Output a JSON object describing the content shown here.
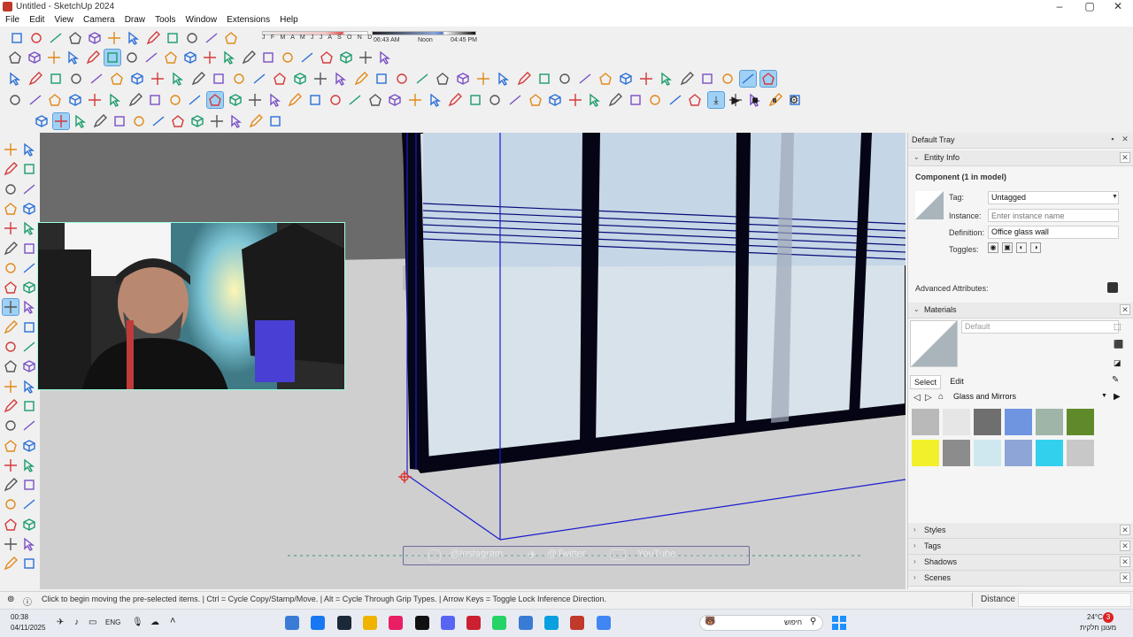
{
  "window": {
    "title": "Untitled - SketchUp 2024"
  },
  "menu": [
    "File",
    "Edit",
    "View",
    "Camera",
    "Draw",
    "Tools",
    "Window",
    "Extensions",
    "Help"
  ],
  "shadow": {
    "months": "J F M A M J J A S O N D",
    "time_start": "06:43 AM",
    "time_noon": "Noon",
    "time_end": "04:45 PM"
  },
  "tray": {
    "title": "Default Tray",
    "entity_info": {
      "header": "Entity Info",
      "heading": "Component (1 in model)",
      "tag_label": "Tag:",
      "tag_value": "Untagged",
      "instance_label": "Instance:",
      "instance_placeholder": "Enter instance name",
      "definition_label": "Definition:",
      "definition_value": "Office glass wall",
      "toggles_label": "Toggles:",
      "advanced_label": "Advanced Attributes:"
    },
    "materials": {
      "header": "Materials",
      "current_name": "Default",
      "tab_select": "Select",
      "tab_edit": "Edit",
      "library": "Glass and Mirrors",
      "swatches": [
        "#b9b9b9",
        "#e6e6e6",
        "#6f6f6f",
        "#6f95e0",
        "#9fb5a8",
        "#5f8a2a",
        "#f2f02a",
        "#8c8c8c",
        "#cfe8f0",
        "#8ea5d8",
        "#33d0ee",
        "#c8c8c8"
      ]
    },
    "collapsed_panels": [
      "Styles",
      "Tags",
      "Shadows",
      "Scenes"
    ]
  },
  "status": {
    "hint": "Click to begin moving the pre-selected items. | Ctrl = Cycle Copy/Stamp/Move. | Alt = Cycle Through Grip Types. | Arrow Keys = Toggle Lock Inference Direction.",
    "measure_label": "Distance"
  },
  "social": {
    "instagram": "@Instagram",
    "twitter": "@Twitter",
    "youtube": "YouTube"
  },
  "taskbar": {
    "time": "00:38",
    "date": "04/11/2025",
    "lang": "ENG",
    "weather": "24°C",
    "weather_desc": "מעונן חלקית",
    "search": "חיפוש",
    "notif_count": "3",
    "app_colors": [
      "#3a7bd5",
      "#1877f2",
      "#1b2838",
      "#f0b400",
      "#e91e63",
      "#111111",
      "#5865f2",
      "#cc1f2f",
      "#25d366",
      "#3a7bd5",
      "#0aa0e0",
      "#c0392b",
      "#4285f4"
    ]
  }
}
